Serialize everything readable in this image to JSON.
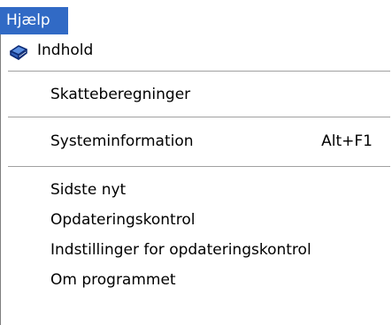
{
  "menubar": {
    "title": "Hjælp"
  },
  "menu": {
    "contents": {
      "label": "Indhold",
      "icon": "help-book-icon"
    },
    "tax_calculations": {
      "label": "Skatteberegninger"
    },
    "system_info": {
      "label": "Systeminformation",
      "shortcut": "Alt+F1"
    },
    "latest_news": {
      "label": "Sidste nyt"
    },
    "update_check": {
      "label": "Opdateringskontrol"
    },
    "update_settings": {
      "label": "Indstillinger for opdateringskontrol"
    },
    "about": {
      "label": "Om programmet"
    }
  },
  "colors": {
    "highlight": "#316ac5",
    "separator": "#a0a0a0"
  }
}
